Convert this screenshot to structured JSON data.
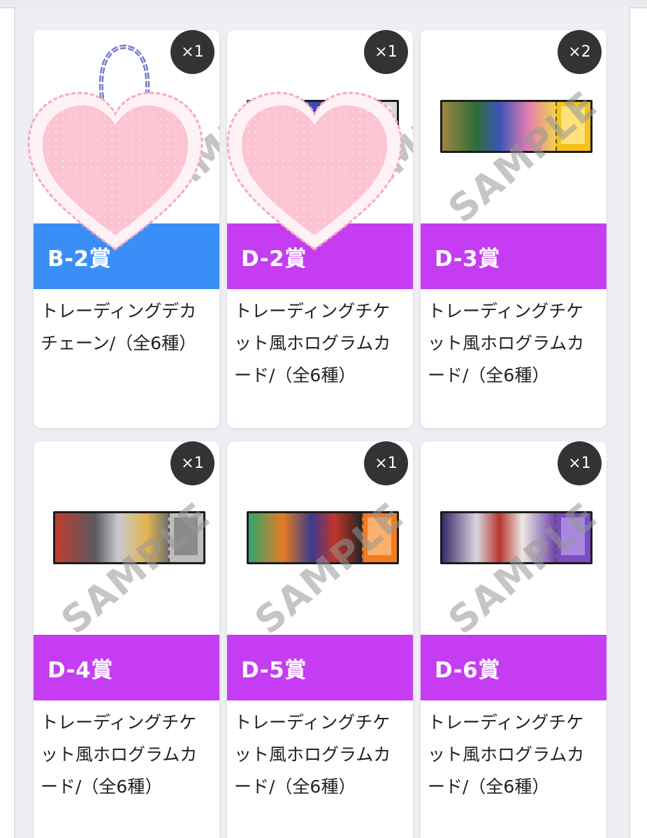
{
  "cards": [
    {
      "prize": "B-2賞",
      "description": "トレーディングデカチェーン/（全6種）",
      "quantity": "×1",
      "bar_color": "#3a8ef7",
      "kind": "chain"
    },
    {
      "prize": "D-2賞",
      "description": "トレーディングチケット風ホログラムカード/（全6種）",
      "quantity": "×1",
      "bar_color": "#c53cf2",
      "kind": "ticket-heart"
    },
    {
      "prize": "D-3賞",
      "description": "トレーディングチケット風ホログラムカード/（全6種）",
      "quantity": "×2",
      "bar_color": "#c53cf2",
      "kind": "ticket"
    },
    {
      "prize": "D-4賞",
      "description": "トレーディングチケット風ホログラムカード/（全6種）",
      "quantity": "×1",
      "bar_color": "#c53cf2",
      "kind": "ticket"
    },
    {
      "prize": "D-5賞",
      "description": "トレーディングチケット風ホログラムカード/（全6種）",
      "quantity": "×1",
      "bar_color": "#c53cf2",
      "kind": "ticket"
    },
    {
      "prize": "D-6賞",
      "description": "トレーディングチケット風ホログラムカード/（全6種）",
      "quantity": "×1",
      "bar_color": "#c53cf2",
      "kind": "ticket"
    }
  ],
  "watermark_text": "SAMPLE"
}
